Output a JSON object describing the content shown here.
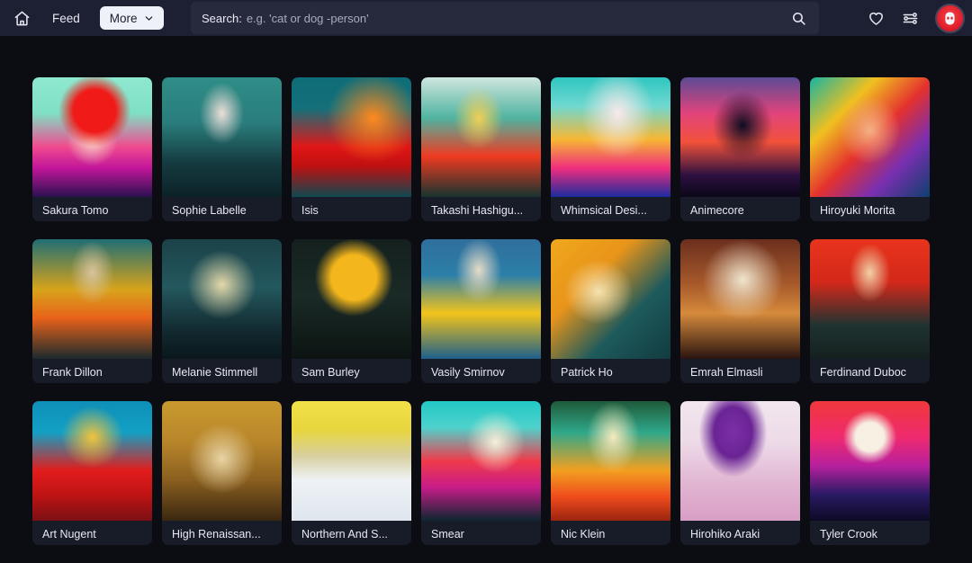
{
  "header": {
    "home_icon": "home-icon",
    "feed_label": "Feed",
    "more_label": "More",
    "more_chevron_icon": "chevron-down-icon",
    "search_prefix": "Search:",
    "search_value": "",
    "search_placeholder": "e.g. 'cat or dog -person'",
    "search_icon": "search-icon",
    "favorites_icon": "heart-icon",
    "settings_icon": "sliders-icon",
    "avatar_icon": "user-avatar"
  },
  "colors": {
    "header_bg": "#1d2033",
    "page_bg": "#0c0c13",
    "card_bg": "#181b28",
    "search_bg": "#272a3d",
    "accent_button": "#eff1f8",
    "avatar_red": "#e01f2a",
    "text_primary": "#e8eaf2"
  },
  "grid": {
    "cards": [
      {
        "label": "Sakura Tomo",
        "thumb": "t1"
      },
      {
        "label": "Sophie Labelle",
        "thumb": "t2"
      },
      {
        "label": "Isis",
        "thumb": "t3"
      },
      {
        "label": "Takashi Hashigu...",
        "thumb": "t4"
      },
      {
        "label": "Whimsical Desi...",
        "thumb": "t5"
      },
      {
        "label": "Animecore",
        "thumb": "t6"
      },
      {
        "label": "Hiroyuki Morita",
        "thumb": "t7"
      },
      {
        "label": "Frank Dillon",
        "thumb": "t8"
      },
      {
        "label": "Melanie Stimmell",
        "thumb": "t9"
      },
      {
        "label": "Sam Burley",
        "thumb": "t10"
      },
      {
        "label": "Vasily Smirnov",
        "thumb": "t11"
      },
      {
        "label": "Patrick Ho",
        "thumb": "t12"
      },
      {
        "label": "Emrah Elmasli",
        "thumb": "t13"
      },
      {
        "label": "Ferdinand Duboc",
        "thumb": "t14"
      },
      {
        "label": "Art Nugent",
        "thumb": "t15"
      },
      {
        "label": "High Renaissan...",
        "thumb": "t16"
      },
      {
        "label": "Northern And S...",
        "thumb": "t17"
      },
      {
        "label": "Smear",
        "thumb": "t18"
      },
      {
        "label": "Nic Klein",
        "thumb": "t19"
      },
      {
        "label": "Hirohiko Araki",
        "thumb": "t20"
      },
      {
        "label": "Tyler Crook",
        "thumb": "t21"
      }
    ]
  },
  "thumbs": {
    "t1": "radial-gradient(circle at 52% 28%, #f01b18 0%, #f01b18 20%, rgba(240,27,24,0) 34%), radial-gradient(ellipse at 50% 52%, #f7d9c8 0%, rgba(247,217,200,0) 30%), linear-gradient(180deg, #8ee8cf 0%, #7fe0c6 30%, #f04b8e 58%, #c2159a 76%, #2a1150 100%)",
    "t2": "radial-gradient(ellipse at 50% 30%, #eddfd9 0%, rgba(237,223,217,0) 26%), linear-gradient(180deg, #2f8d87 0%, #2a7d7c 38%, #143a3f 72%, #0c2227 100%)",
    "t3": "radial-gradient(ellipse at 68% 34%, #ff8a1e 0%, rgba(255,138,30,0) 40%), linear-gradient(180deg, #0e6d78 0%, #14707a 26%, #e01616 58%, #c01010 74%, #0f4850 100%)",
    "t4": "radial-gradient(ellipse at 48% 34%, #f2cf55 0%, rgba(242,207,85,0) 28%), linear-gradient(180deg, #cfe6df 0%, #4fb3a0 34%, #ef3a20 66%, #17342f 100%)",
    "t5": "radial-gradient(ellipse at 56% 30%, #f7e9ea 0%, rgba(247,233,234,0) 38%), linear-gradient(180deg, #2fc6c0 0%, #6fd8d0 24%, #f7b733 52%, #ef2d7e 76%, #1a2b9e 100%)",
    "t6": "radial-gradient(ellipse at 52% 40%, #0d0d22 0%, rgba(13,13,34,0) 34%), linear-gradient(180deg, #5b4a94 0%, #e2447c 30%, #f2513a 54%, #2c1040 82%, #0b0718 100%)",
    "t7": "radial-gradient(ellipse at 50% 44%, #f4b085 0%, rgba(244,176,133,0) 36%), linear-gradient(135deg, #16b4a2 0%, #f0c020 28%, #e4312e 52%, #7a2fb0 74%, #0f3f6e 100%)",
    "t8": "radial-gradient(ellipse at 50% 28%, #d8c39c 0%, rgba(216,195,156,0) 26%), linear-gradient(180deg, #1f6e74 0%, #d8a31b 42%, #e8621a 66%, #1c2a2c 100%)",
    "t9": "radial-gradient(circle at 50% 38%, #e4d8a9 0%, rgba(228,216,169,0) 36%), linear-gradient(180deg, #1b4248 0%, #23585e 40%, #11282e 78%, #0a171b 100%)",
    "t10": "radial-gradient(circle at 52% 32%, #f3b61c 0%, #f3b61c 22%, rgba(243,182,28,0) 38%), linear-gradient(180deg, #14201e 0%, #1a2a26 48%, #0c1412 100%)",
    "t11": "radial-gradient(ellipse at 48% 26%, #e8dcc8 0%, rgba(232,220,200,0) 26%), linear-gradient(180deg, #2f6f9c 0%, #2c7fa8 30%, #f2c41a 62%, #1e5f8c 100%)",
    "t12": "radial-gradient(ellipse at 40% 44%, #f7e3b0 0%, rgba(247,227,176,0) 34%), linear-gradient(135deg, #f0a81c 0%, #e8941a 34%, #1d5a5c 66%, #123b40 100%)",
    "t13": "radial-gradient(circle at 52% 34%, #efe5cf 0%, rgba(239,229,207,0) 40%), linear-gradient(180deg, #6b2f1e 0%, #a85a2a 38%, #d58a3c 62%, #2a1410 100%)",
    "t14": "radial-gradient(ellipse at 50% 28%, #f0d2a8 0%, rgba(240,210,168,0) 24%), linear-gradient(180deg, #e8341c 0%, #d4281a 36%, #1f3330 72%, #14201f 100%)",
    "t15": "radial-gradient(circle at 50% 30%, #f2c23c 0%, rgba(242,194,60,0) 30%), linear-gradient(180deg, #0f8fb8 0%, #12a0c4 26%, #e21c1c 58%, #c01414 78%, #7a0f14 100%)",
    "t16": "radial-gradient(ellipse at 50% 48%, #e8d4a4 0%, rgba(232,212,164,0) 40%), linear-gradient(180deg, #c8992e 0%, #b8862a 34%, #8a5f20 66%, #3a2710 100%)",
    "t17": "linear-gradient(180deg, #f2e04a 0%, #e8d63e 24%, #d8cfa0 46%, #eef2f6 66%, #dfe6ee 100%)",
    "t18": "radial-gradient(ellipse at 62% 34%, #f5efd8 0%, rgba(245,239,216,0) 28%), linear-gradient(180deg, #22c8c4 0%, #4fd2cc 22%, #f03a4a 50%, #c81c88 72%, #0e2630 100%)",
    "t19": "radial-gradient(ellipse at 52% 30%, #f6e9bd 0%, rgba(246,233,189,0) 30%), linear-gradient(180deg, #1f5a3a 0%, #2fa88a 26%, #f2a020 58%, #ef4b1c 80%, #9b2410 100%)",
    "t20": "radial-gradient(ellipse at 44% 26%, #7d2fa8 0%, #6a2494 20%, rgba(106,36,148,0) 36%), linear-gradient(180deg, #f2e6ee 0%, #eddbe8 34%, #e2b8d4 66%, #d89ec4 100%)",
    "t21": "radial-gradient(circle at 50% 30%, #f6efe2 0%, #f6efe2 14%, rgba(246,239,226,0) 26%), linear-gradient(180deg, #f0383c 0%, #ef2a6e 30%, #b8209e 54%, #2a1a64 78%, #0d0a24 100%)"
  }
}
